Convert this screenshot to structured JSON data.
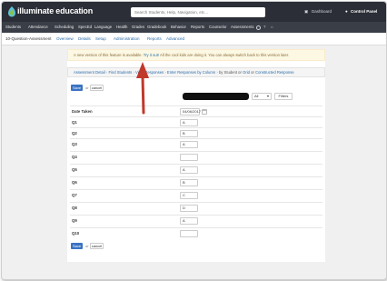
{
  "topbar": {
    "brand": "illuminate education",
    "search_placeholder": "Search Students, Help, Navigation, etc...",
    "dashboard_label": "Dashboard",
    "user_label": "Control Panel"
  },
  "nav": {
    "items": [
      "Students",
      "Attendance",
      "Scheduling",
      "SpecEd",
      "Language",
      "Health",
      "Grades",
      "Gradebook",
      "Behavior",
      "Reports",
      "Counselor",
      "Assessments"
    ]
  },
  "subnav": {
    "title": "10-Question-Assessment",
    "items": [
      "Overview",
      "Details",
      "Setup",
      "Administration",
      "Reports",
      "Advanced"
    ]
  },
  "alert": {
    "text_before": "A new version of this feature is available.",
    "link": "Try it out!",
    "text_after": "All the cool kids are doing it. You can always switch back to this version later."
  },
  "breadcrumb": {
    "items": [
      {
        "label": "Assessment Detail",
        "link": true
      },
      {
        "label": "Find Students",
        "link": true
      },
      {
        "label": "View Responses",
        "link": true
      },
      {
        "label": "Enter Responses by Column",
        "link": true
      },
      {
        "label": "by Student",
        "link": false
      },
      {
        "label": "or",
        "link": false
      },
      {
        "label": "Grid",
        "link": true
      },
      {
        "label": "or",
        "link": false
      },
      {
        "label": "Constructed Response",
        "link": true
      }
    ]
  },
  "actions": {
    "save": "Save",
    "or": "or",
    "cancel": "cancel"
  },
  "filters": {
    "select_value": "All",
    "filter_button": "Filters"
  },
  "table": {
    "date_label": "Date Taken",
    "date_value": "04/06/2017",
    "rows": [
      {
        "label": "Q1",
        "value": "A"
      },
      {
        "label": "Q2",
        "value": "B"
      },
      {
        "label": "Q3",
        "value": "A"
      },
      {
        "label": "Q4",
        "value": ""
      },
      {
        "label": "Q5",
        "value": "A"
      },
      {
        "label": "Q6",
        "value": "B"
      },
      {
        "label": "Q7",
        "value": "C"
      },
      {
        "label": "Q8",
        "value": "D"
      },
      {
        "label": "Q9",
        "value": "A"
      },
      {
        "label": "Q10",
        "value": ""
      }
    ]
  },
  "colors": {
    "topbar": "#2b2e36",
    "navbar": "#3a3e47",
    "link": "#2a6ca8",
    "save_button": "#3b73c3",
    "annotation_arrow": "#c0392b"
  }
}
